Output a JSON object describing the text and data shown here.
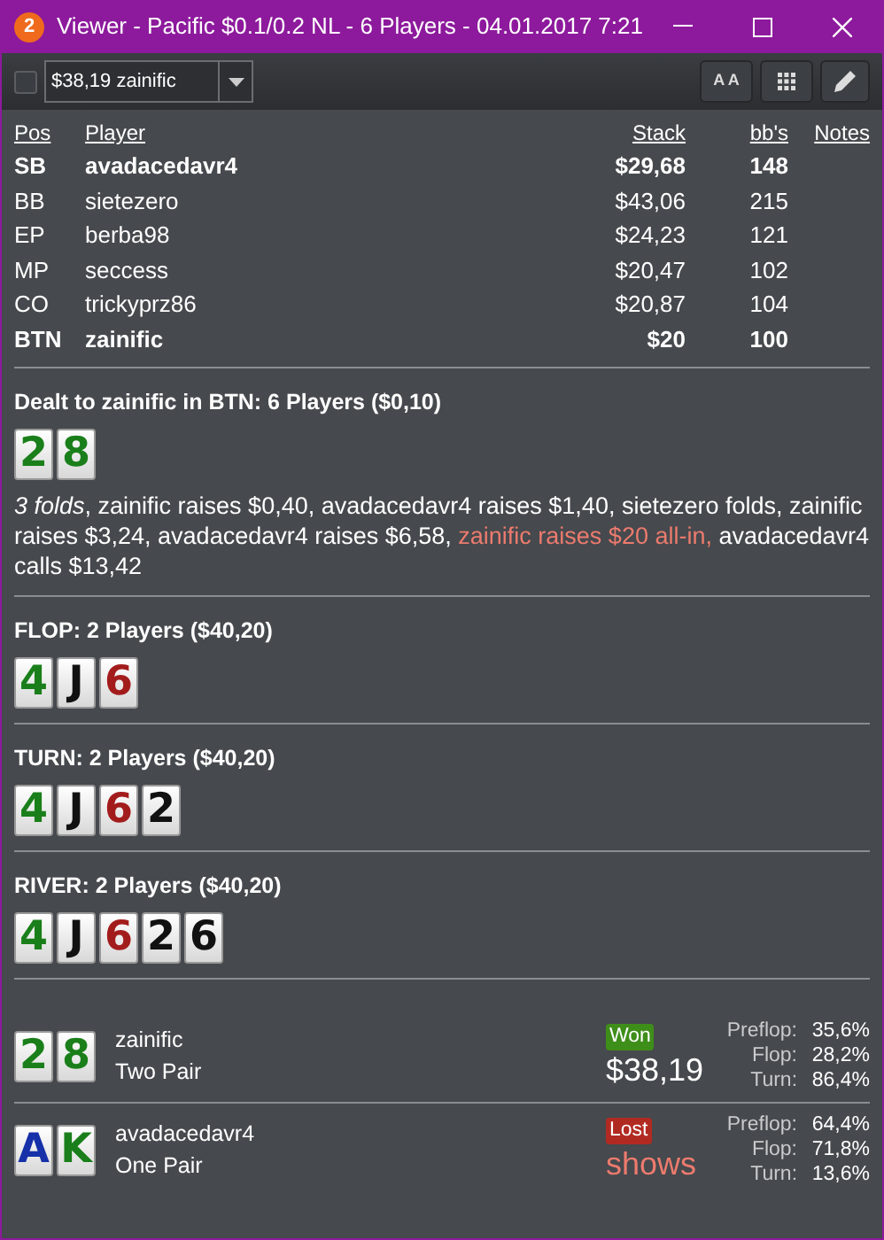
{
  "window": {
    "badge": "2",
    "title": "Viewer - Pacific $0.1/0.2 NL - 6 Players - 04.01.2017 7:21"
  },
  "toolbar": {
    "checked": false,
    "player_select": "$38,19 zainific",
    "font_button": "A A"
  },
  "players": {
    "columns": [
      "Pos",
      "Player",
      "Stack",
      "bb's",
      "Notes"
    ],
    "rows": [
      {
        "pos": "SB",
        "player": "avadacedavr4",
        "stack": "$29,68",
        "bbs": "148",
        "emphasized": true
      },
      {
        "pos": "BB",
        "player": "sietezero",
        "stack": "$43,06",
        "bbs": "215",
        "emphasized": false
      },
      {
        "pos": "EP",
        "player": "berba98",
        "stack": "$24,23",
        "bbs": "121",
        "emphasized": false
      },
      {
        "pos": "MP",
        "player": "seccess",
        "stack": "$20,47",
        "bbs": "102",
        "emphasized": false
      },
      {
        "pos": "CO",
        "player": "trickyprz86",
        "stack": "$20,87",
        "bbs": "104",
        "emphasized": false
      },
      {
        "pos": "BTN",
        "player": "zainific",
        "stack": "$20",
        "bbs": "100",
        "emphasized": true
      }
    ]
  },
  "streets": [
    {
      "heading": "Dealt to zainific in BTN: 6 Players ($0,10)",
      "cards": [
        {
          "rank": "2",
          "color": "#1a7f1a"
        },
        {
          "rank": "8",
          "color": "#1a7f1a"
        }
      ],
      "actions": [
        {
          "kind": "italic",
          "text": "3 folds"
        },
        {
          "kind": "plain",
          "text": ", zainific raises $0,40, avadacedavr4 raises $1,40, sietezero folds, zainific raises $3,24, avadacedavr4 raises $6,58, "
        },
        {
          "kind": "allin",
          "text": "zainific raises $20 all-in,"
        },
        {
          "kind": "plain",
          "text": " avadacedavr4 calls $13,42"
        }
      ]
    },
    {
      "heading": "FLOP: 2 Players ($40,20)",
      "cards": [
        {
          "rank": "4",
          "color": "#1a7f1a"
        },
        {
          "rank": "J",
          "color": "#111111"
        },
        {
          "rank": "6",
          "color": "#a31c1c"
        }
      ]
    },
    {
      "heading": "TURN: 2 Players ($40,20)",
      "cards": [
        {
          "rank": "4",
          "color": "#1a7f1a"
        },
        {
          "rank": "J",
          "color": "#111111"
        },
        {
          "rank": "6",
          "color": "#a31c1c"
        },
        {
          "rank": "2",
          "color": "#111111"
        }
      ]
    },
    {
      "heading": "RIVER: 2 Players ($40,20)",
      "cards": [
        {
          "rank": "4",
          "color": "#1a7f1a"
        },
        {
          "rank": "J",
          "color": "#111111"
        },
        {
          "rank": "6",
          "color": "#a31c1c"
        },
        {
          "rank": "2",
          "color": "#111111"
        },
        {
          "rank": "6",
          "color": "#111111"
        }
      ]
    }
  ],
  "results": [
    {
      "cards": [
        {
          "rank": "2",
          "color": "#1a7f1a"
        },
        {
          "rank": "8",
          "color": "#1a7f1a"
        }
      ],
      "player": "zainific",
      "hand": "Two Pair",
      "outcome": {
        "kind": "won",
        "label": "Won"
      },
      "amount": "$38,19",
      "equity": [
        {
          "label": "Preflop:",
          "value": "35,6%"
        },
        {
          "label": "Flop:",
          "value": "28,2%"
        },
        {
          "label": "Turn:",
          "value": "86,4%"
        }
      ]
    },
    {
      "cards": [
        {
          "rank": "A",
          "color": "#1530a8"
        },
        {
          "rank": "K",
          "color": "#1a7f1a"
        }
      ],
      "player": "avadacedavr4",
      "hand": "One Pair",
      "outcome": {
        "kind": "lost",
        "label": "Lost"
      },
      "amount": "shows",
      "equity": [
        {
          "label": "Preflop:",
          "value": "64,4%"
        },
        {
          "label": "Flop:",
          "value": "71,8%"
        },
        {
          "label": "Turn:",
          "value": "13,6%"
        }
      ]
    }
  ]
}
